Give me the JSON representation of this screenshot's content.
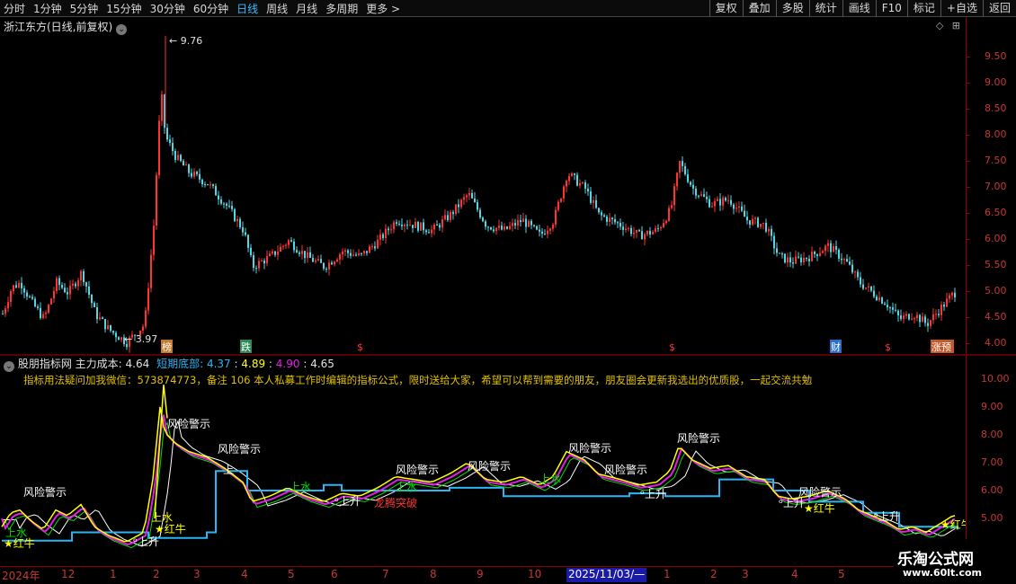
{
  "toolbar": {
    "period_tabs": [
      "分时",
      "1分钟",
      "5分钟",
      "15分钟",
      "30分钟",
      "60分钟",
      "日线",
      "周线",
      "月线",
      "多周期",
      "更多 >"
    ],
    "active_tab": "日线",
    "buttons": [
      "复权",
      "叠加",
      "多股",
      "统计",
      "画线",
      "F10",
      "标记",
      "+自选",
      "返回"
    ]
  },
  "price_panel": {
    "title": "浙江东方(日线,前复权)",
    "tools": [
      "◇",
      "⊞"
    ],
    "high_label": "9.76",
    "low_label": "3.97",
    "axis_labels": [
      "9.50",
      "9.00",
      "8.50",
      "8.00",
      "7.50",
      "7.00",
      "6.50",
      "6.00",
      "5.50",
      "5.00",
      "4.50",
      "4.00"
    ],
    "markers": [
      "榜",
      "跌",
      "$",
      "$",
      "财",
      "$",
      "涨预"
    ]
  },
  "indicator_panel": {
    "name": "股朋指标网",
    "main_cost_label": "主力成本:",
    "main_cost_value": "4.64",
    "short_bottom_label": "短期底部:",
    "short_bottom_value": "4.37",
    "v3": "4.89",
    "v4": "4.90",
    "v5": "4.65",
    "note": "指标用法疑问加我微信：573874773，备注 106 本人私募工作时编辑的指标公式，限时送给大家，希望可以帮到需要的朋友，朋友圈会更新我选出的优质股，一起交流共勉",
    "axis_labels": [
      "10.00",
      "9.00",
      "8.00",
      "7.00",
      "6.00",
      "5.00"
    ],
    "signal_labels": [
      "风险警示",
      "风险警示",
      "风险警示",
      "风险警示",
      "风险警示",
      "风险警示",
      "风险警示",
      "风险警示",
      "风险警示",
      "上升",
      "上升",
      "上升",
      "上升",
      "上升",
      "红牛",
      "红牛",
      "红牛",
      "红牛",
      "上水",
      "上水",
      "上水",
      "上水",
      "上水",
      "龙腾突破",
      "上"
    ],
    "colors": {
      "price_up": "#ff3333",
      "price_down": "#4fd7e6",
      "cost_line": "#29b6f6",
      "magenta_line": "#e020e0",
      "yellow_line": "#ffff00",
      "white_line": "#ffffff",
      "green_line": "#00e000"
    }
  },
  "time_axis": {
    "labels": [
      "2024年",
      "12",
      "1",
      "2",
      "3",
      "4",
      "5",
      "6",
      "7",
      "8",
      "9",
      "10",
      "1",
      "2",
      "3",
      "4",
      "5"
    ],
    "cursor": "2025/11/03/—"
  },
  "watermark": {
    "title": "乐淘公式网",
    "url": "www.60lt.com"
  }
}
